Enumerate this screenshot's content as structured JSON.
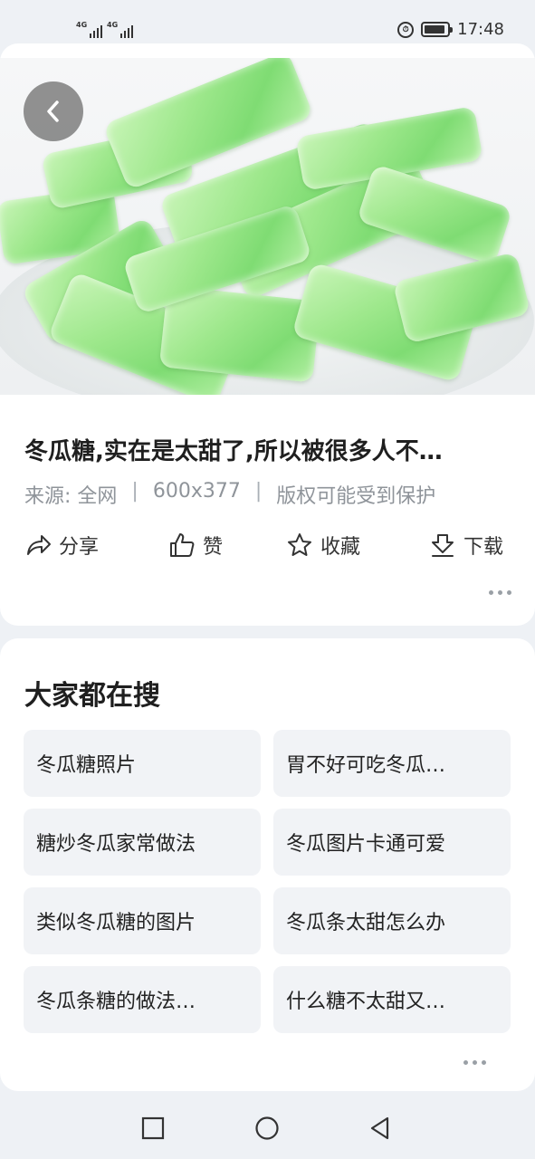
{
  "status_bar": {
    "time": "17:48",
    "net1": "4G",
    "net2": "4G",
    "alarm_icon": "alarm-icon",
    "battery_level": 0.9
  },
  "image_card": {
    "back_icon": "chevron-left-icon",
    "title": "冬瓜糖,实在是太甜了,所以被很多人不…",
    "source": "来源: 全网",
    "separator": "|",
    "dimensions": "600x377",
    "copyright": "版权可能受到保护",
    "actions": [
      {
        "label": "分享",
        "icon": "share-icon"
      },
      {
        "label": "赞",
        "icon": "thumbs-up-icon"
      },
      {
        "label": "收藏",
        "icon": "star-icon"
      },
      {
        "label": "下载",
        "icon": "download-icon"
      }
    ],
    "more_icon": "more-dots-icon"
  },
  "search_card": {
    "title": "大家都在搜",
    "items": [
      "冬瓜糖照片",
      "胃不好可吃冬瓜…",
      "糖炒冬瓜家常做法",
      "冬瓜图片卡通可爱",
      "类似冬瓜糖的图片",
      "冬瓜条太甜怎么办",
      "冬瓜条糖的做法…",
      "什么糖不太甜又…"
    ],
    "more_icon": "more-dots-icon"
  },
  "nav_bar": {
    "recent": "square-icon",
    "home": "circle-icon",
    "back": "triangle-back-icon"
  },
  "colors": {
    "background": "#eef1f5",
    "card": "#ffffff",
    "chip": "#f1f3f6",
    "muted_text": "#8f949a",
    "candy_green": "#9ee88c"
  }
}
